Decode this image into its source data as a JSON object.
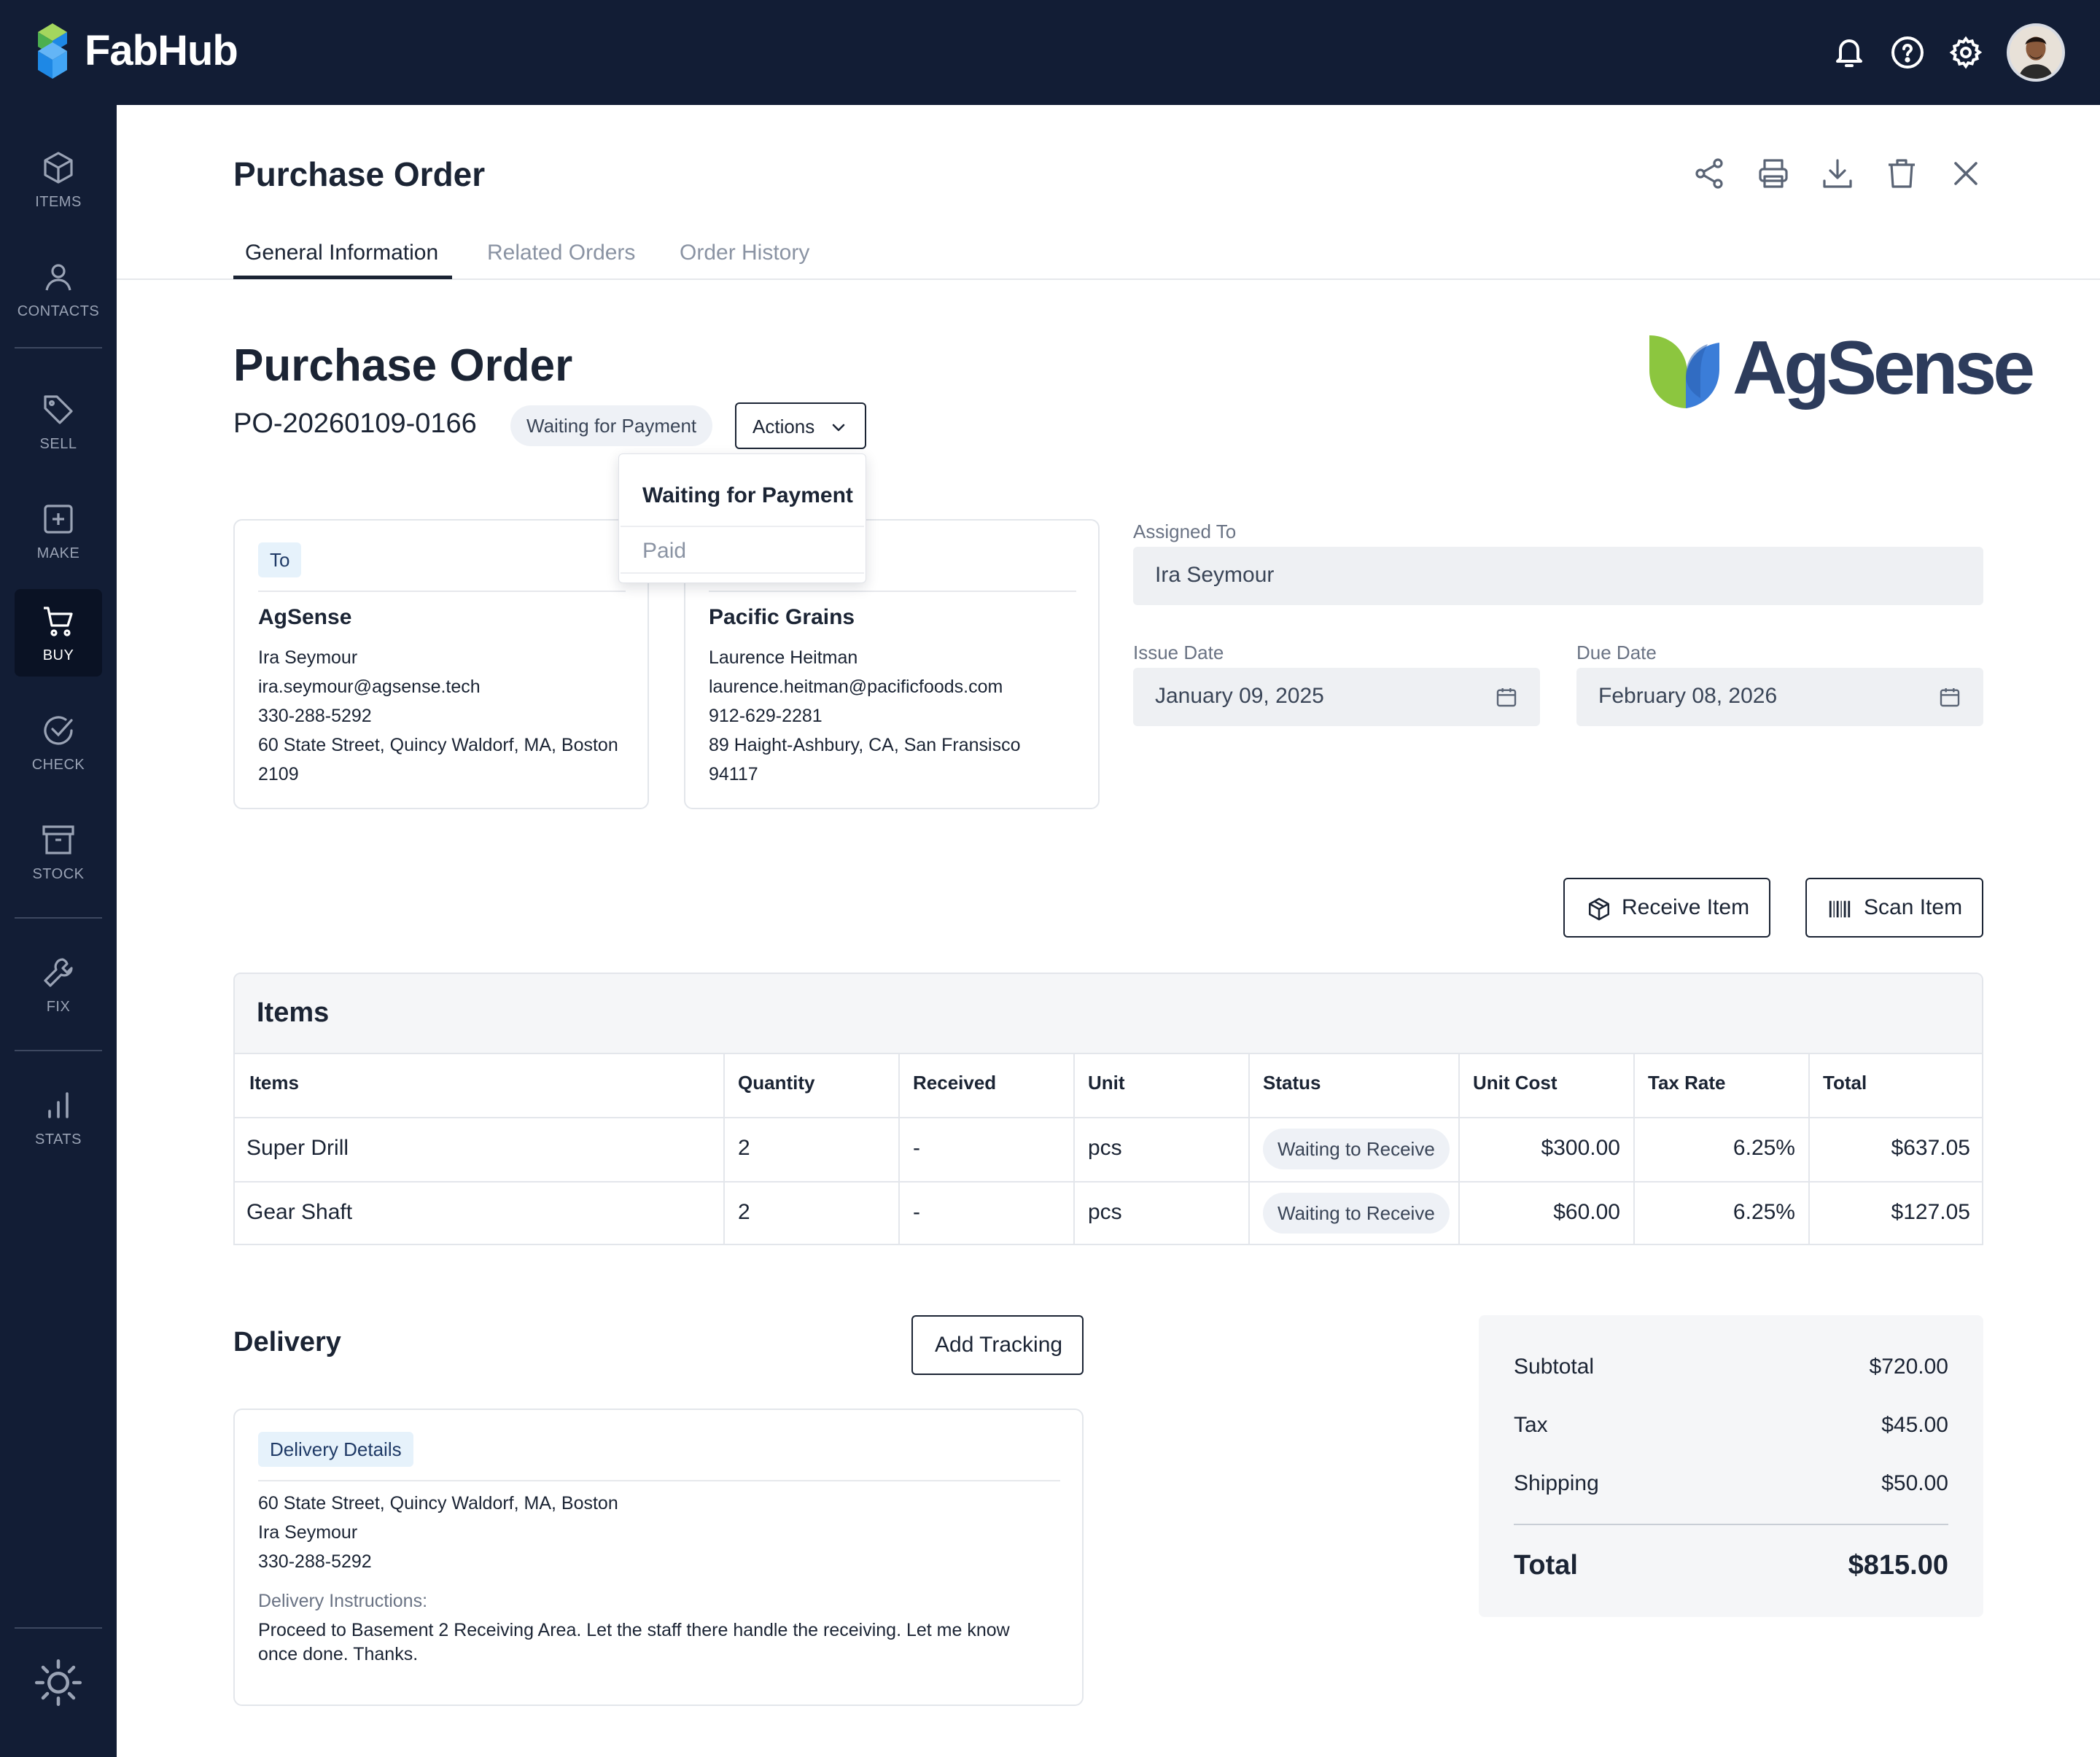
{
  "app": {
    "brand": "FabHub"
  },
  "sidebar": {
    "items": [
      {
        "label": "ITEMS",
        "icon": "cube-icon"
      },
      {
        "label": "CONTACTS",
        "icon": "person-icon"
      },
      {
        "label": "SELL",
        "icon": "tag-icon"
      },
      {
        "label": "MAKE",
        "icon": "plus-square-icon"
      },
      {
        "label": "BUY",
        "icon": "cart-icon",
        "active": true
      },
      {
        "label": "CHECK",
        "icon": "check-circle-icon"
      },
      {
        "label": "STOCK",
        "icon": "archive-icon"
      },
      {
        "label": "FIX",
        "icon": "wrench-icon"
      },
      {
        "label": "STATS",
        "icon": "bar-chart-icon"
      }
    ]
  },
  "header": {
    "title": "Purchase Order",
    "tabs": [
      {
        "label": "General Information",
        "active": true
      },
      {
        "label": "Related Orders"
      },
      {
        "label": "Order History"
      }
    ]
  },
  "order": {
    "title": "Purchase Order",
    "number": "PO-20260109-0166",
    "status": "Waiting for Payment",
    "actions_label": "Actions",
    "vendor_logo_text": "AgSense",
    "dropdown": {
      "options": [
        "Waiting for Payment",
        "Paid"
      ],
      "selected": "Waiting for Payment"
    }
  },
  "to_card": {
    "tag": "To",
    "company": "AgSense",
    "contact": "Ira Seymour",
    "email": "ira.seymour@agsense.tech",
    "phone": "330-288-5292",
    "address1": "60 State Street, Quincy Waldorf, MA, Boston",
    "address2": "2109"
  },
  "from_card": {
    "company": "Pacific Grains",
    "contact": "Laurence Heitman",
    "email": "laurence.heitman@pacificfoods.com",
    "phone": "912-629-2281",
    "address1": "89 Haight-Ashbury, CA, San Fransisco",
    "address2": "94117"
  },
  "fields": {
    "assigned_label": "Assigned To",
    "assigned_value": "Ira Seymour",
    "issue_label": "Issue Date",
    "issue_value": "January 09, 2025",
    "due_label": "Due Date",
    "due_value": "February 08, 2026"
  },
  "buttons": {
    "receive": "Receive Item",
    "scan": "Scan Item",
    "add_tracking": "Add Tracking"
  },
  "items": {
    "title": "Items",
    "columns": [
      "Items",
      "Quantity",
      "Received",
      "Unit",
      "Status",
      "Unit Cost",
      "Tax Rate",
      "Total"
    ],
    "rows": [
      {
        "name": "Super Drill",
        "qty": "2",
        "received": "-",
        "unit": "pcs",
        "status": "Waiting to Receive",
        "unit_cost": "$300.00",
        "tax": "6.25%",
        "total": "$637.05"
      },
      {
        "name": "Gear Shaft",
        "qty": "2",
        "received": "-",
        "unit": "pcs",
        "status": "Waiting to Receive",
        "unit_cost": "$60.00",
        "tax": "6.25%",
        "total": "$127.05"
      }
    ]
  },
  "delivery": {
    "title": "Delivery",
    "tag": "Delivery Details",
    "address": "60 State Street, Quincy Waldorf, MA, Boston",
    "contact": "Ira Seymour",
    "phone": "330-288-5292",
    "instructions_label": "Delivery Instructions:",
    "instructions": "Proceed to Basement 2 Receiving Area. Let the staff there handle the receiving. Let me know once done. Thanks."
  },
  "summary": {
    "subtotal_label": "Subtotal",
    "subtotal": "$720.00",
    "tax_label": "Tax",
    "tax": "$45.00",
    "shipping_label": "Shipping",
    "shipping": "$50.00",
    "total_label": "Total",
    "total": "$815.00"
  },
  "colors": {
    "navy": "#121d35",
    "accent_green": "#8cc63f",
    "accent_blue": "#3b7dd8",
    "tag_bg": "#e6f2fb"
  }
}
